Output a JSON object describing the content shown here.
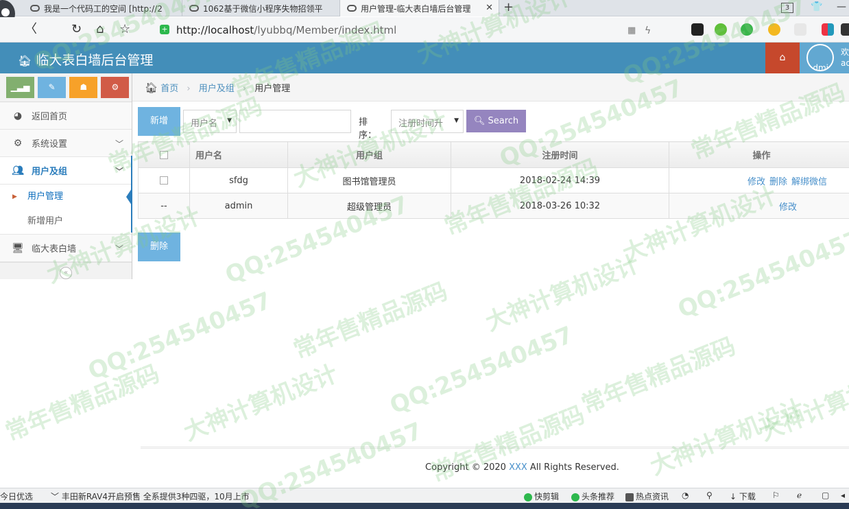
{
  "browser": {
    "tabs": [
      {
        "title": "我是一个代码工的空间 [http://2"
      },
      {
        "title": "1062基于微信小程序失物招领平"
      },
      {
        "title": "用户管理-临大表白墙后台管理"
      }
    ],
    "new_tab": "+",
    "tab_count": "3",
    "url_host": "http://localhost",
    "url_path": "/lyubbq/Member/index.html"
  },
  "app": {
    "title": "临大表白墙后台管理",
    "user_name": "admin",
    "welcome": "欢",
    "welcome2": "ad"
  },
  "sidebar": {
    "items": [
      {
        "label": "返回首页",
        "icon": "dashboard-icon"
      },
      {
        "label": "系统设置",
        "icon": "gear-icon"
      },
      {
        "label": "用户及组",
        "icon": "users-icon"
      },
      {
        "label": "临大表白墙",
        "icon": "desktop-icon"
      }
    ],
    "sub_items": [
      {
        "label": "用户管理"
      },
      {
        "label": "新增用户"
      }
    ]
  },
  "breadcrumb": {
    "home": "首页",
    "level1": "用户及组",
    "level2": "用户管理"
  },
  "toolbar": {
    "add_label": "新增",
    "search_field_select": "用户名",
    "search_input": "",
    "sort_label": "排序：",
    "sort_select": "注册时间升",
    "search_label": "Search",
    "delete_label": "删除"
  },
  "table": {
    "headers": [
      "用户名",
      "用户组",
      "注册时间",
      "操作"
    ],
    "rows": [
      {
        "username": "sfdg",
        "group": "图书馆管理员",
        "time": "2018-02-24 14:39",
        "actions": [
          "修改",
          "删除",
          "解绑微信"
        ],
        "check": "",
        "alt": false
      },
      {
        "username": "admin",
        "group": "超级管理员",
        "time": "2018-03-26 10:32",
        "actions": [
          "修改"
        ],
        "check": "--",
        "alt": true
      }
    ]
  },
  "footer": {
    "prefix": "Copyright © 2020 ",
    "brand": "XXX",
    "suffix": " All Rights Reserved."
  },
  "statusbar": {
    "news_today": "今日优选",
    "headline": "丰田新RAV4开启预售 全系提供3种四驱，10月上市",
    "items": [
      "快剪辑",
      "头条推荐",
      "热点资讯",
      "下载"
    ]
  },
  "watermark": {
    "texts": [
      "QQ:254540457",
      "常年售精品源码",
      "大神计算机设计"
    ]
  },
  "colors": {
    "header": "#438eb9",
    "home_button": "#c6482c",
    "search_button": "#9585bf",
    "primary_button": "#6fb3e0",
    "link": "#478fca"
  }
}
